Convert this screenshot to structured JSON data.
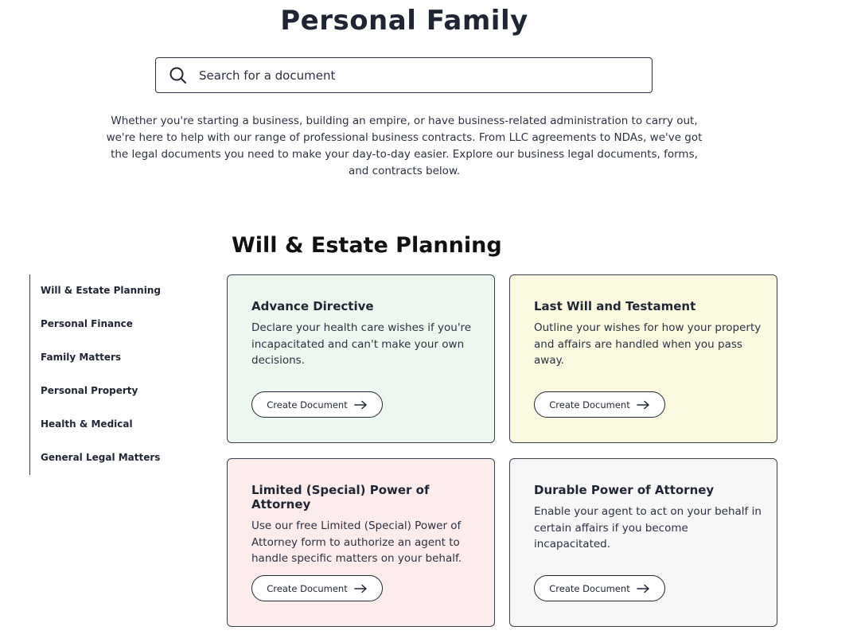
{
  "header": {
    "title": "Personal Family"
  },
  "search": {
    "placeholder": "Search for a document",
    "icon": "search-icon"
  },
  "intro": {
    "text": "Whether you're starting a business, building an empire, or have business-related administration to carry out, we're here to help with our range of professional business contracts. From LLC agreements to NDAs, we've got the legal documents you need to make your day-to-day easier. Explore our business legal documents, forms, and contracts below."
  },
  "section": {
    "title": "Will & Estate Planning"
  },
  "sidebar": {
    "items": [
      {
        "label": "Will & Estate Planning"
      },
      {
        "label": "Personal Finance"
      },
      {
        "label": "Family Matters"
      },
      {
        "label": "Personal Property"
      },
      {
        "label": "Health & Medical"
      },
      {
        "label": "General Legal Matters"
      }
    ]
  },
  "cards": [
    {
      "title": "Advance Directive",
      "description": "Declare your health care wishes if you're incapacitated and can't make your own decisions.",
      "button_label": "Create Document",
      "background": "#ecf8ef"
    },
    {
      "title": "Last Will and Testament",
      "description": "Outline your wishes for how your property and affairs are handled when you pass away.",
      "button_label": "Create Document",
      "background": "#fbfae0"
    },
    {
      "title": "Limited (Special) Power of Attorney",
      "description": "Use our free Limited (Special) Power of Attorney form to authorize an agent to handle specific matters on your behalf.",
      "button_label": "Create Document",
      "background": "#fcecec"
    },
    {
      "title": "Durable Power of Attorney",
      "description": "Enable your agent to act on your behalf in certain affairs if you become incapacitated.",
      "button_label": "Create Document",
      "background": "#f7f7f8"
    }
  ],
  "colors": {
    "text": "#1f2533",
    "border": "#3a3f4a"
  },
  "icons": {
    "button_arrow": "arrow-right-icon"
  }
}
